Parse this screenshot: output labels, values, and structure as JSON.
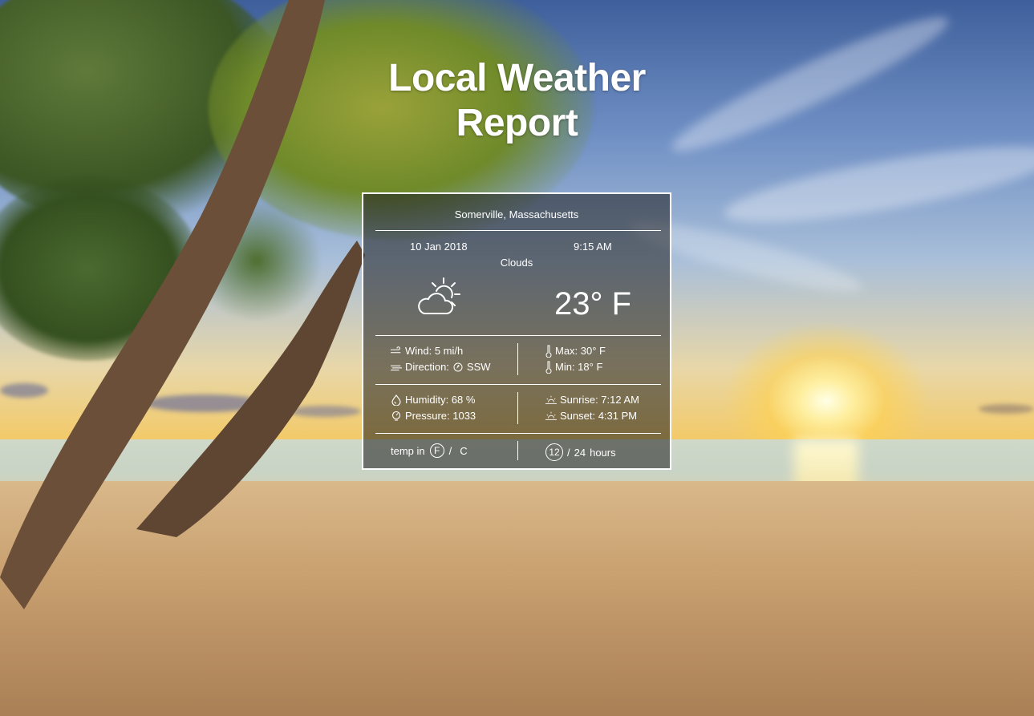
{
  "page": {
    "title_line1": "Local Weather",
    "title_line2": "Report"
  },
  "weather": {
    "location": "Somerville, Massachusetts",
    "date": "10 Jan 2018",
    "time": "9:15 AM",
    "condition": "Clouds",
    "condition_icon": "partly-cloudy-icon",
    "temperature": "23° F",
    "wind": "Wind: 5 mi/h",
    "direction_label": "Direction:",
    "direction_value": "SSW",
    "max": "Max: 30° F",
    "min": "Min:  18° F",
    "humidity": "Humidity: 68 %",
    "pressure": "Pressure: 1033",
    "sunrise": "Sunrise: 7:12 AM",
    "sunset": "Sunset:  4:31 PM"
  },
  "controls": {
    "temp_label": "temp in",
    "temp_f": "F",
    "temp_sep": "/",
    "temp_c": "C",
    "hours_12": "12",
    "hours_sep": "/",
    "hours_24": "24",
    "hours_label": "hours"
  }
}
